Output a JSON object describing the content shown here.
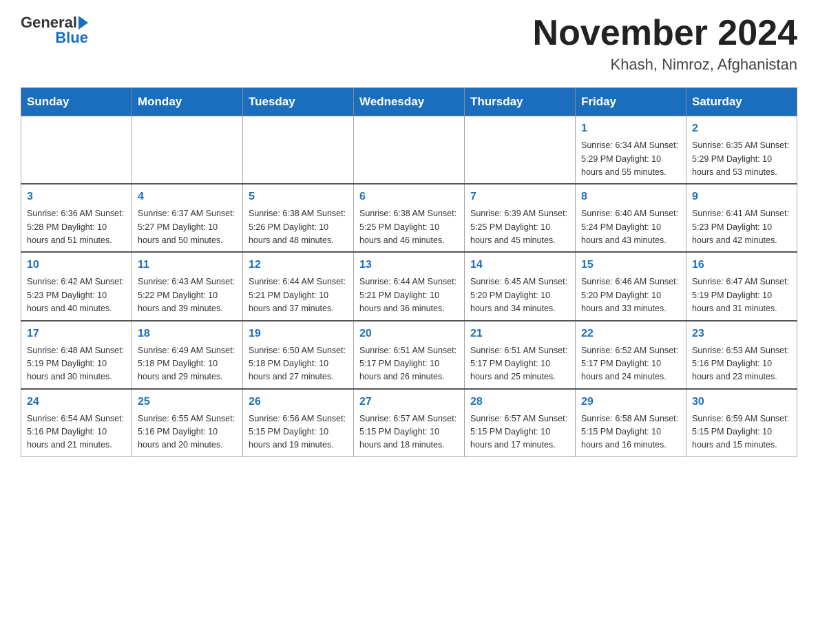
{
  "header": {
    "logo_general": "General",
    "logo_blue": "Blue",
    "month_title": "November 2024",
    "location": "Khash, Nimroz, Afghanistan"
  },
  "days_of_week": [
    "Sunday",
    "Monday",
    "Tuesday",
    "Wednesday",
    "Thursday",
    "Friday",
    "Saturday"
  ],
  "weeks": [
    [
      {
        "day": "",
        "info": ""
      },
      {
        "day": "",
        "info": ""
      },
      {
        "day": "",
        "info": ""
      },
      {
        "day": "",
        "info": ""
      },
      {
        "day": "",
        "info": ""
      },
      {
        "day": "1",
        "info": "Sunrise: 6:34 AM\nSunset: 5:29 PM\nDaylight: 10 hours\nand 55 minutes."
      },
      {
        "day": "2",
        "info": "Sunrise: 6:35 AM\nSunset: 5:29 PM\nDaylight: 10 hours\nand 53 minutes."
      }
    ],
    [
      {
        "day": "3",
        "info": "Sunrise: 6:36 AM\nSunset: 5:28 PM\nDaylight: 10 hours\nand 51 minutes."
      },
      {
        "day": "4",
        "info": "Sunrise: 6:37 AM\nSunset: 5:27 PM\nDaylight: 10 hours\nand 50 minutes."
      },
      {
        "day": "5",
        "info": "Sunrise: 6:38 AM\nSunset: 5:26 PM\nDaylight: 10 hours\nand 48 minutes."
      },
      {
        "day": "6",
        "info": "Sunrise: 6:38 AM\nSunset: 5:25 PM\nDaylight: 10 hours\nand 46 minutes."
      },
      {
        "day": "7",
        "info": "Sunrise: 6:39 AM\nSunset: 5:25 PM\nDaylight: 10 hours\nand 45 minutes."
      },
      {
        "day": "8",
        "info": "Sunrise: 6:40 AM\nSunset: 5:24 PM\nDaylight: 10 hours\nand 43 minutes."
      },
      {
        "day": "9",
        "info": "Sunrise: 6:41 AM\nSunset: 5:23 PM\nDaylight: 10 hours\nand 42 minutes."
      }
    ],
    [
      {
        "day": "10",
        "info": "Sunrise: 6:42 AM\nSunset: 5:23 PM\nDaylight: 10 hours\nand 40 minutes."
      },
      {
        "day": "11",
        "info": "Sunrise: 6:43 AM\nSunset: 5:22 PM\nDaylight: 10 hours\nand 39 minutes."
      },
      {
        "day": "12",
        "info": "Sunrise: 6:44 AM\nSunset: 5:21 PM\nDaylight: 10 hours\nand 37 minutes."
      },
      {
        "day": "13",
        "info": "Sunrise: 6:44 AM\nSunset: 5:21 PM\nDaylight: 10 hours\nand 36 minutes."
      },
      {
        "day": "14",
        "info": "Sunrise: 6:45 AM\nSunset: 5:20 PM\nDaylight: 10 hours\nand 34 minutes."
      },
      {
        "day": "15",
        "info": "Sunrise: 6:46 AM\nSunset: 5:20 PM\nDaylight: 10 hours\nand 33 minutes."
      },
      {
        "day": "16",
        "info": "Sunrise: 6:47 AM\nSunset: 5:19 PM\nDaylight: 10 hours\nand 31 minutes."
      }
    ],
    [
      {
        "day": "17",
        "info": "Sunrise: 6:48 AM\nSunset: 5:19 PM\nDaylight: 10 hours\nand 30 minutes."
      },
      {
        "day": "18",
        "info": "Sunrise: 6:49 AM\nSunset: 5:18 PM\nDaylight: 10 hours\nand 29 minutes."
      },
      {
        "day": "19",
        "info": "Sunrise: 6:50 AM\nSunset: 5:18 PM\nDaylight: 10 hours\nand 27 minutes."
      },
      {
        "day": "20",
        "info": "Sunrise: 6:51 AM\nSunset: 5:17 PM\nDaylight: 10 hours\nand 26 minutes."
      },
      {
        "day": "21",
        "info": "Sunrise: 6:51 AM\nSunset: 5:17 PM\nDaylight: 10 hours\nand 25 minutes."
      },
      {
        "day": "22",
        "info": "Sunrise: 6:52 AM\nSunset: 5:17 PM\nDaylight: 10 hours\nand 24 minutes."
      },
      {
        "day": "23",
        "info": "Sunrise: 6:53 AM\nSunset: 5:16 PM\nDaylight: 10 hours\nand 23 minutes."
      }
    ],
    [
      {
        "day": "24",
        "info": "Sunrise: 6:54 AM\nSunset: 5:16 PM\nDaylight: 10 hours\nand 21 minutes."
      },
      {
        "day": "25",
        "info": "Sunrise: 6:55 AM\nSunset: 5:16 PM\nDaylight: 10 hours\nand 20 minutes."
      },
      {
        "day": "26",
        "info": "Sunrise: 6:56 AM\nSunset: 5:15 PM\nDaylight: 10 hours\nand 19 minutes."
      },
      {
        "day": "27",
        "info": "Sunrise: 6:57 AM\nSunset: 5:15 PM\nDaylight: 10 hours\nand 18 minutes."
      },
      {
        "day": "28",
        "info": "Sunrise: 6:57 AM\nSunset: 5:15 PM\nDaylight: 10 hours\nand 17 minutes."
      },
      {
        "day": "29",
        "info": "Sunrise: 6:58 AM\nSunset: 5:15 PM\nDaylight: 10 hours\nand 16 minutes."
      },
      {
        "day": "30",
        "info": "Sunrise: 6:59 AM\nSunset: 5:15 PM\nDaylight: 10 hours\nand 15 minutes."
      }
    ]
  ]
}
